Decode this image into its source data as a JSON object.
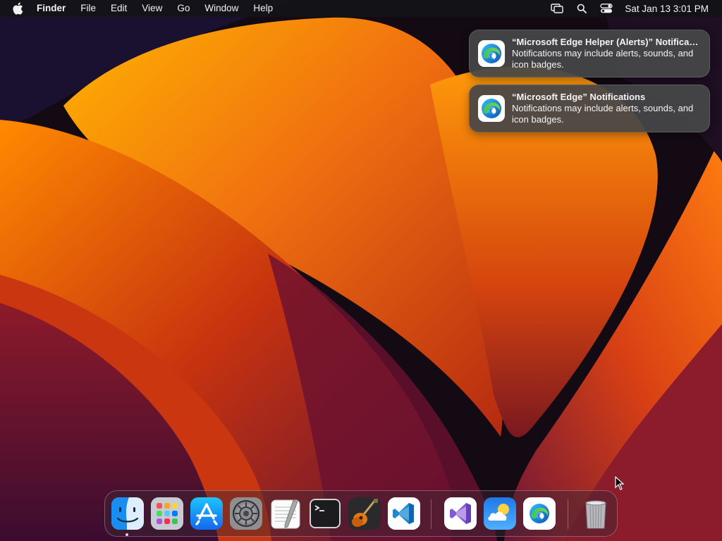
{
  "menubar": {
    "app_name": "Finder",
    "menus": [
      "File",
      "Edit",
      "View",
      "Go",
      "Window",
      "Help"
    ],
    "clock": "Sat Jan 13  3:01 PM",
    "status_icons": [
      "screen-mirroring-icon",
      "search-icon",
      "control-center-icon"
    ]
  },
  "notifications": [
    {
      "title": "“Microsoft Edge Helper (Alerts)” Notifications",
      "body": "Notifications may include alerts, sounds, and icon badges.",
      "icon": "microsoft-edge-icon"
    },
    {
      "title": "“Microsoft Edge” Notifications",
      "body": "Notifications may include alerts, sounds, and icon badges.",
      "icon": "microsoft-edge-icon"
    }
  ],
  "dock": {
    "apps": [
      "Finder",
      "Launchpad",
      "App Store",
      "System Settings",
      "TextEdit",
      "Terminal",
      "GarageBand",
      "Visual Studio Code"
    ],
    "recent_apps": [
      "Visual Studio",
      "Weather",
      "Microsoft Edge"
    ],
    "trash": "Trash",
    "running": [
      "Finder"
    ]
  },
  "colors": {
    "accent_edge_blue": "#1e88e5",
    "accent_edge_green": "#3bc26a",
    "vscode_blue": "#1f8ad2",
    "visual_studio_purple": "#8659d6"
  }
}
